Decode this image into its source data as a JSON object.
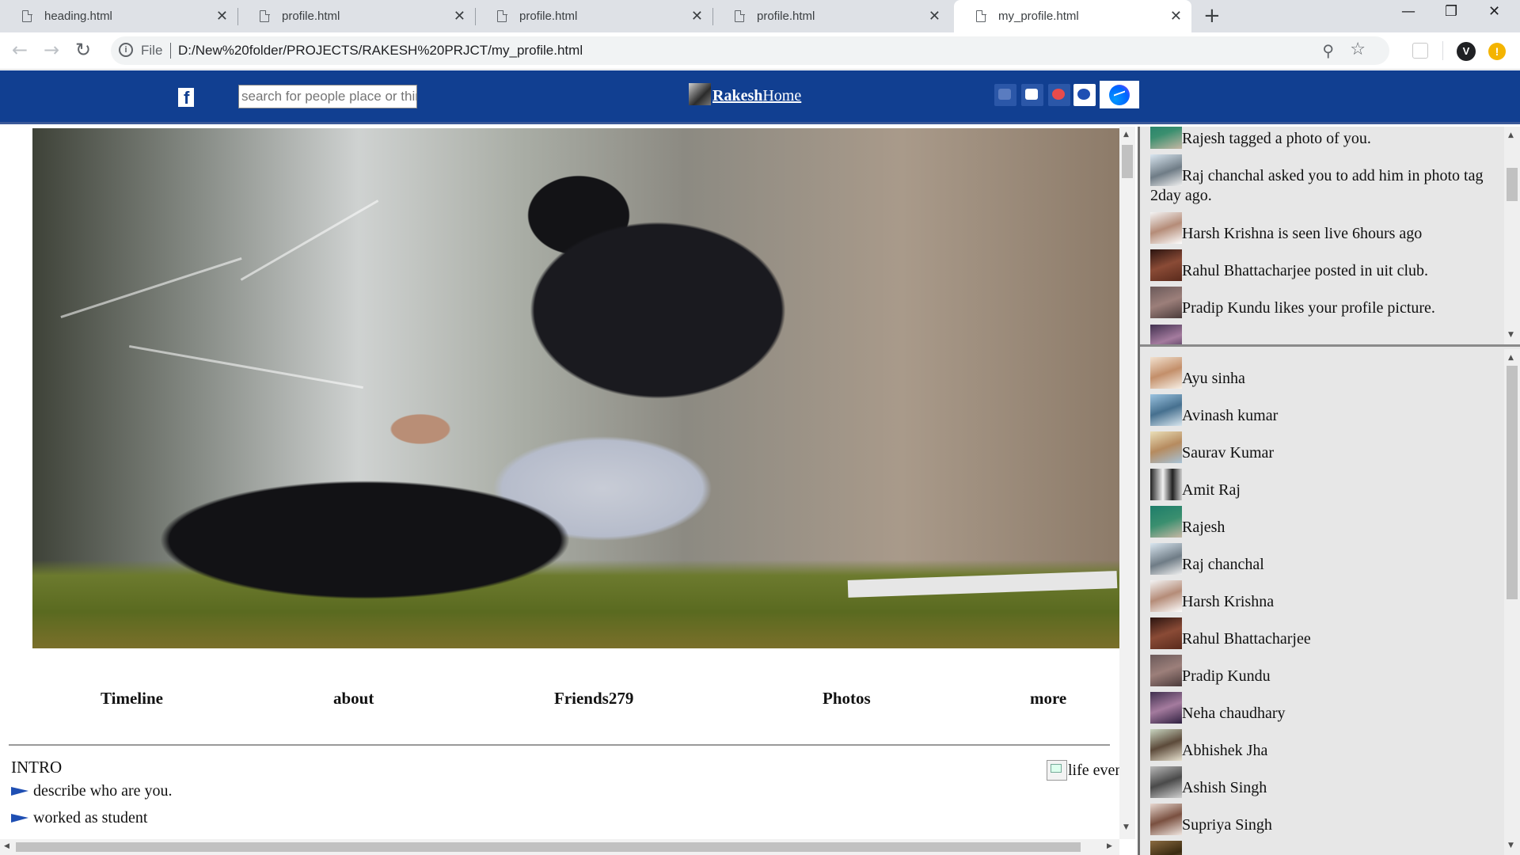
{
  "browser": {
    "tabs": [
      {
        "title": "heading.html"
      },
      {
        "title": "profile.html"
      },
      {
        "title": "profile.html"
      },
      {
        "title": "profile.html"
      },
      {
        "title": "my_profile.html"
      }
    ],
    "scheme_label": "File",
    "url": "D:/New%20folder/PROJECTS/RAKESH%20PRJCT/my_profile.html",
    "profile_initial": "V"
  },
  "header": {
    "search_placeholder": "search for people place or things",
    "brand_name": "Rakesh",
    "home_label": "Home",
    "colors": {
      "bar": "#113f91",
      "accent": "#3b5998"
    }
  },
  "profile_tabs": [
    "Timeline",
    "about",
    "Friends279",
    "Photos",
    "more"
  ],
  "intro": {
    "title": "INTRO",
    "items": [
      "describe who are you.",
      "worked as student"
    ],
    "life_event_alt": "life events"
  },
  "notifications": [
    "Rajesh tagged a photo of you.",
    "Raj chanchal asked you to add him in photo tag 2day ago.",
    "Harsh Krishna is seen live 6hours ago",
    "Rahul Bhattacharjee posted in uit club.",
    "Pradip Kundu likes your profile picture."
  ],
  "friends": [
    "Ayu sinha",
    "Avinash kumar",
    "Saurav Kumar",
    "Amit Raj",
    "Rajesh",
    "Raj chanchal",
    "Harsh Krishna",
    "Rahul Bhattacharjee",
    "Pradip Kundu",
    "Neha chaudhary",
    "Abhishek Jha",
    "Ashish Singh",
    "Supriya Singh"
  ]
}
